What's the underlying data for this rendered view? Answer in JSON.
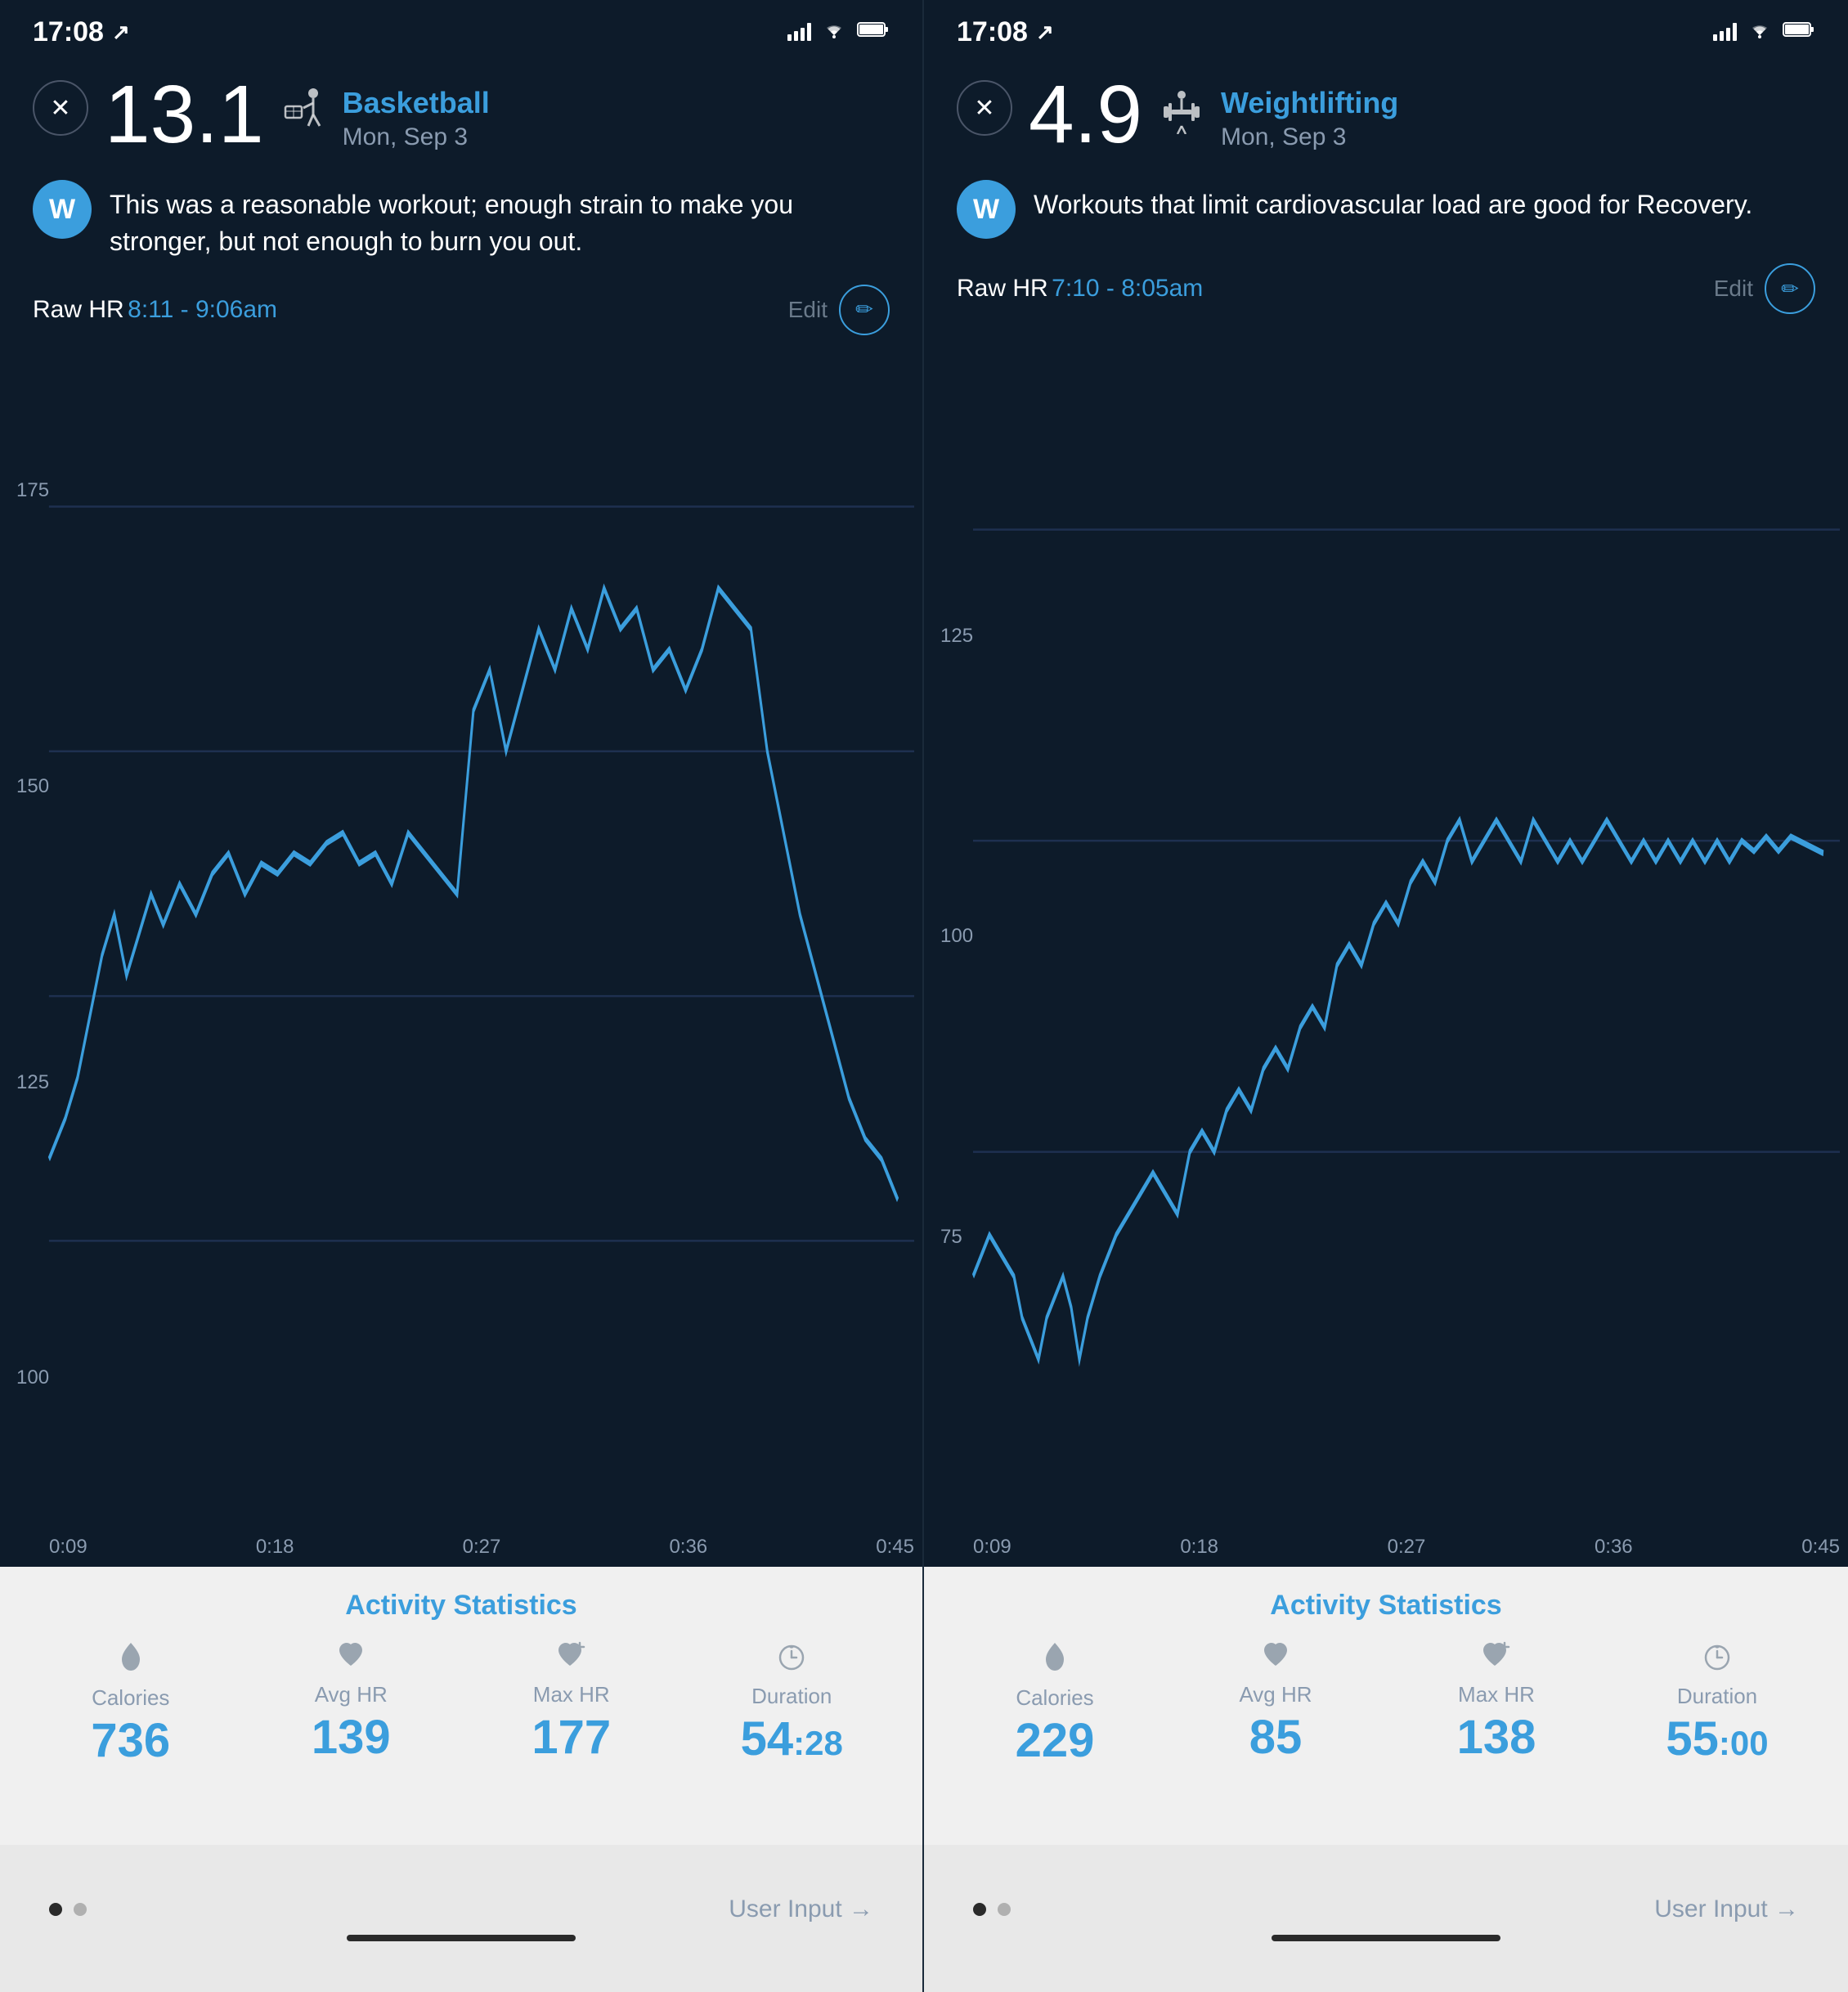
{
  "left": {
    "status": {
      "time": "17:08",
      "location": "↗"
    },
    "workout": {
      "close_label": "✕",
      "strain": "13.1",
      "activity_icon": "🏀",
      "name": "Basketball",
      "date": "Mon, Sep 3",
      "avatar_label": "W",
      "message": "This was a reasonable workout; enough strain to make you stronger, but not enough to burn you out.",
      "raw_hr_label": "Raw HR",
      "raw_hr_time": "8:11 - 9:06am",
      "edit_label": "Edit",
      "edit_icon": "✏"
    },
    "chart": {
      "y_labels": [
        "175",
        "150",
        "125",
        "100"
      ],
      "x_labels": [
        "0:09",
        "0:18",
        "0:27",
        "0:36",
        "0:45"
      ]
    },
    "stats": {
      "title": "Activity Statistics",
      "items": [
        {
          "icon": "🔥",
          "label": "Calories",
          "value": "736",
          "unit": ""
        },
        {
          "icon": "♥",
          "label": "Avg HR",
          "value": "139",
          "unit": ""
        },
        {
          "icon": "♥↑",
          "label": "Max HR",
          "value": "177",
          "unit": ""
        },
        {
          "icon": "⏱",
          "label": "Duration",
          "value": "54",
          "unit": ":28"
        }
      ]
    },
    "bottom": {
      "dot1_active": true,
      "dot2_active": false,
      "user_input": "User Input →"
    }
  },
  "right": {
    "status": {
      "time": "17:08",
      "location": "↗"
    },
    "workout": {
      "close_label": "✕",
      "strain": "4.9",
      "activity_icon": "🏋",
      "name": "Weightlifting",
      "date": "Mon, Sep 3",
      "avatar_label": "W",
      "message": "Workouts that limit cardiovascular load are good for Recovery.",
      "raw_hr_label": "Raw HR",
      "raw_hr_time": "7:10 - 8:05am",
      "edit_label": "Edit",
      "edit_icon": "✏"
    },
    "chart": {
      "y_labels": [
        "125",
        "100",
        "75"
      ],
      "x_labels": [
        "0:09",
        "0:18",
        "0:27",
        "0:36",
        "0:45"
      ]
    },
    "stats": {
      "title": "Activity Statistics",
      "items": [
        {
          "icon": "🔥",
          "label": "Calories",
          "value": "229",
          "unit": ""
        },
        {
          "icon": "♥",
          "label": "Avg HR",
          "value": "85",
          "unit": ""
        },
        {
          "icon": "♥↑",
          "label": "Max HR",
          "value": "138",
          "unit": ""
        },
        {
          "icon": "⏱",
          "label": "Duration",
          "value": "55",
          "unit": ":00"
        }
      ]
    },
    "bottom": {
      "dot1_active": true,
      "dot2_active": false,
      "user_input": "User Input →"
    }
  }
}
